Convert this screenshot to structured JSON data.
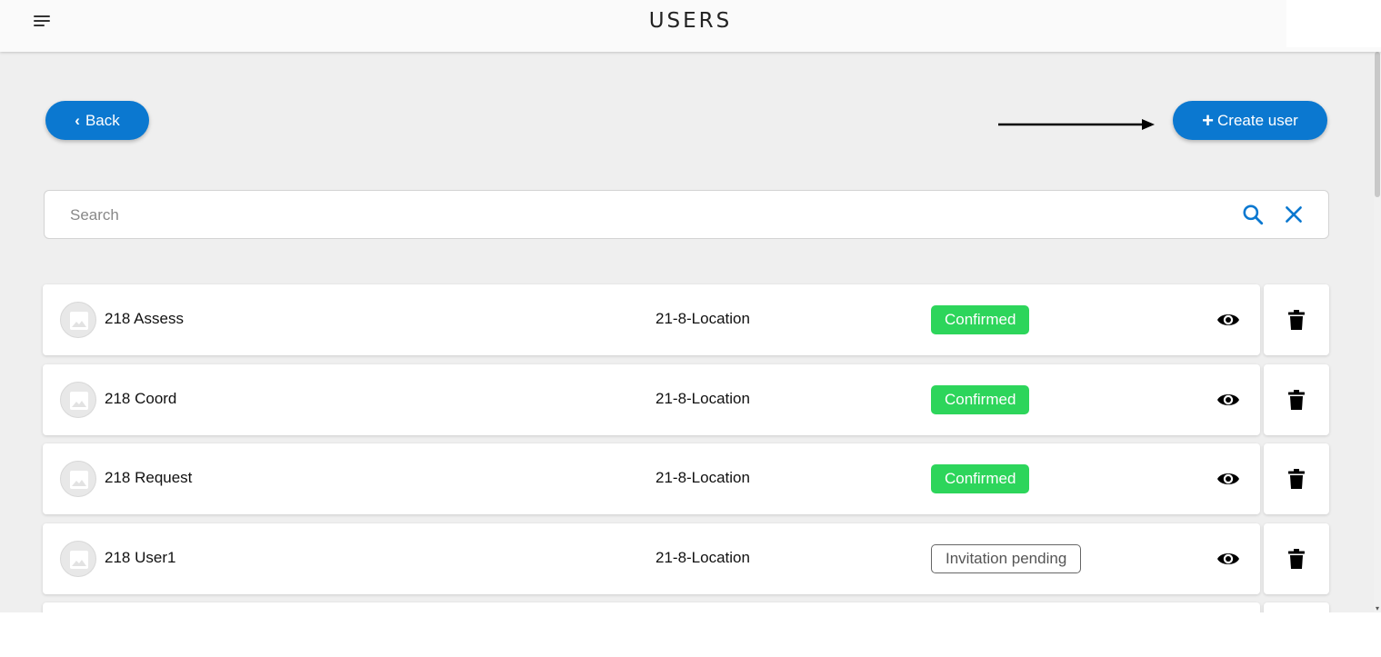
{
  "header": {
    "title": "USERS",
    "menu_icon": "menu-icon"
  },
  "toolbar": {
    "back_label": "Back",
    "back_icon": "chevron-left-icon",
    "create_label": "Create user",
    "create_icon": "plus-icon"
  },
  "search": {
    "placeholder": "Search",
    "value": "",
    "search_icon": "search-icon",
    "clear_icon": "close-icon"
  },
  "users": [
    {
      "name": "218 Assess",
      "location": "21-8-Location",
      "status": "Confirmed",
      "status_type": "confirmed"
    },
    {
      "name": "218 Coord",
      "location": "21-8-Location",
      "status": "Confirmed",
      "status_type": "confirmed"
    },
    {
      "name": "218 Request",
      "location": "21-8-Location",
      "status": "Confirmed",
      "status_type": "confirmed"
    },
    {
      "name": "218 User1",
      "location": "21-8-Location",
      "status": "Invitation pending",
      "status_type": "pending"
    }
  ],
  "colors": {
    "accent": "#0b78d0",
    "confirmed": "#2dd55b",
    "pending_border": "#666666",
    "background": "#efefef"
  }
}
